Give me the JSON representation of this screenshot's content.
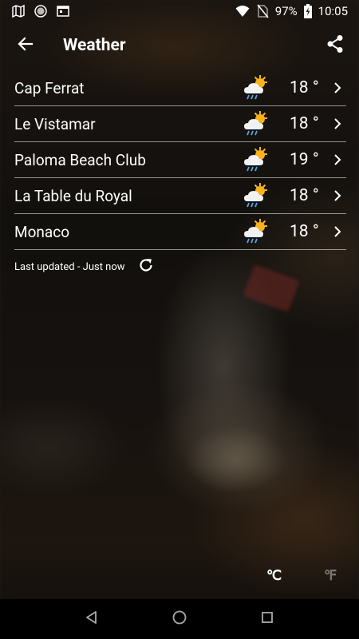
{
  "status_bar": {
    "battery": "97%",
    "time": "10:05",
    "icons": [
      "map-icon",
      "circle-app-icon",
      "calendar-app-icon",
      "wifi-icon",
      "no-sim-icon",
      "battery-charging-icon"
    ]
  },
  "app_bar": {
    "title": "Weather",
    "back_icon": "arrow-left-icon",
    "share_icon": "share-icon"
  },
  "locations": [
    {
      "name": "Cap Ferrat",
      "temp": "18 °",
      "condition_icon": "sun-cloud-rain-icon"
    },
    {
      "name": "Le Vistamar",
      "temp": "18 °",
      "condition_icon": "sun-cloud-rain-icon"
    },
    {
      "name": "Paloma Beach Club",
      "temp": "19 °",
      "condition_icon": "sun-cloud-rain-icon"
    },
    {
      "name": "La Table du Royal",
      "temp": "18 °",
      "condition_icon": "sun-cloud-rain-icon"
    },
    {
      "name": "Monaco",
      "temp": "18 °",
      "condition_icon": "sun-cloud-rain-icon"
    }
  ],
  "last_updated": "Last updated - Just now",
  "units": {
    "celsius": "℃",
    "fahrenheit": "℉",
    "selected": "celsius"
  },
  "colors": {
    "sun": "#f7b21c",
    "cloud": "#f2f2f2",
    "rain": "#4aa8e8",
    "divider": "#ffffff"
  }
}
